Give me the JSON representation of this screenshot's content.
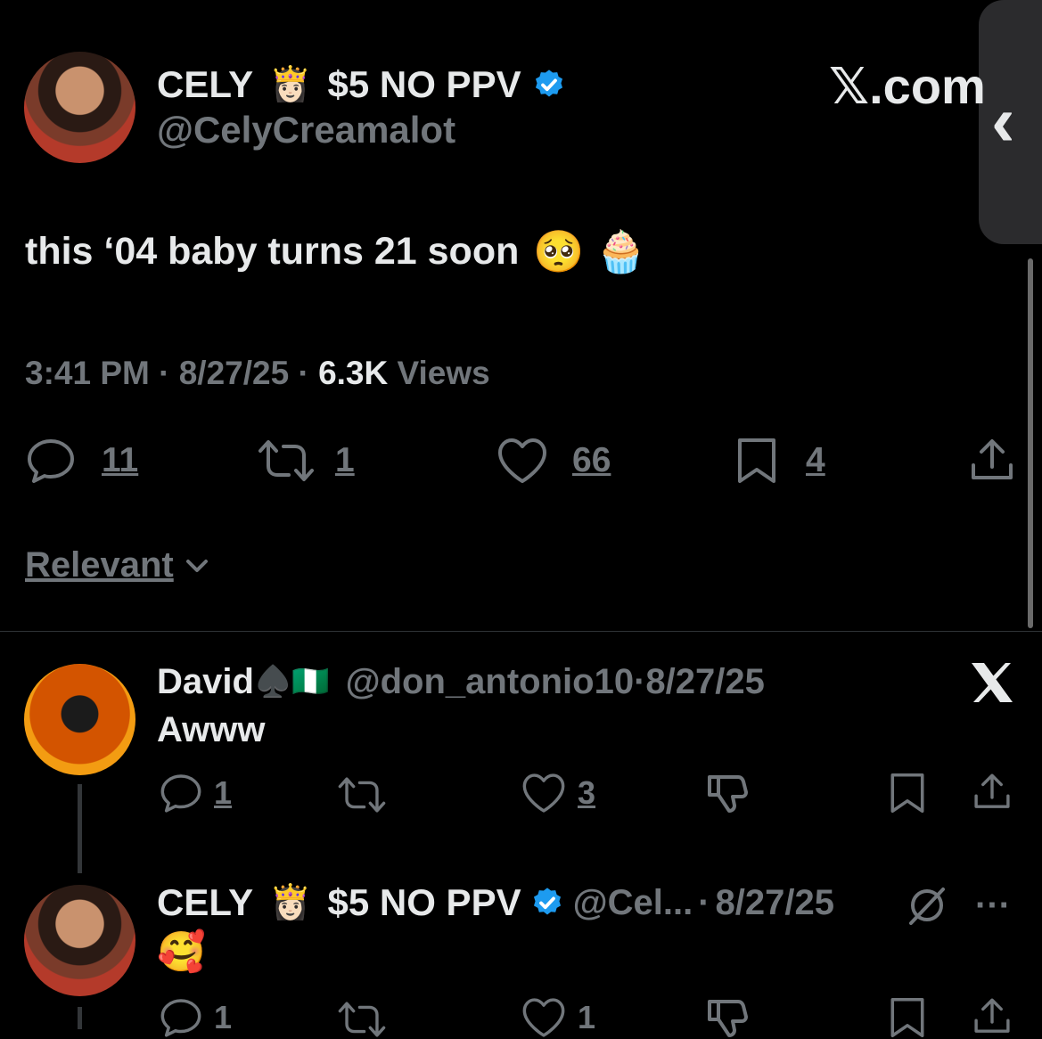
{
  "tweet": {
    "display_name": "CELY",
    "name_suffix": "$5 NO PPV",
    "handle": "@CelyCreamalot",
    "text": "this ‘04 baby turns 21 soon",
    "text_emojis": "🥺 🧁",
    "crown_emoji": "👸🏻",
    "time": "3:41 PM",
    "date": "8/27/25",
    "views_count": "6.3K",
    "views_label": "Views",
    "replies": "11",
    "reposts": "1",
    "likes": "66",
    "bookmarks": "4"
  },
  "brand": {
    "xcom": "𝕏.com"
  },
  "sort": {
    "label": "Relevant"
  },
  "replies": [
    {
      "name": "David",
      "name_emojis": "♠️🇳🇬",
      "handle": "@don_antonio10",
      "date": "8/27/25",
      "text": "Awww",
      "replies": "1",
      "likes": "3"
    },
    {
      "name": "CELY",
      "crown_emoji": "👸🏻",
      "name_suffix": "$5 NO PPV",
      "handle": "@Cel...",
      "date": "8/27/25",
      "text": "🥰",
      "replies": "1",
      "likes": "1"
    }
  ],
  "colors": {
    "accent": "#1d9bf0",
    "muted": "#71767b",
    "text": "#e7e9ea",
    "bg": "#000000"
  }
}
